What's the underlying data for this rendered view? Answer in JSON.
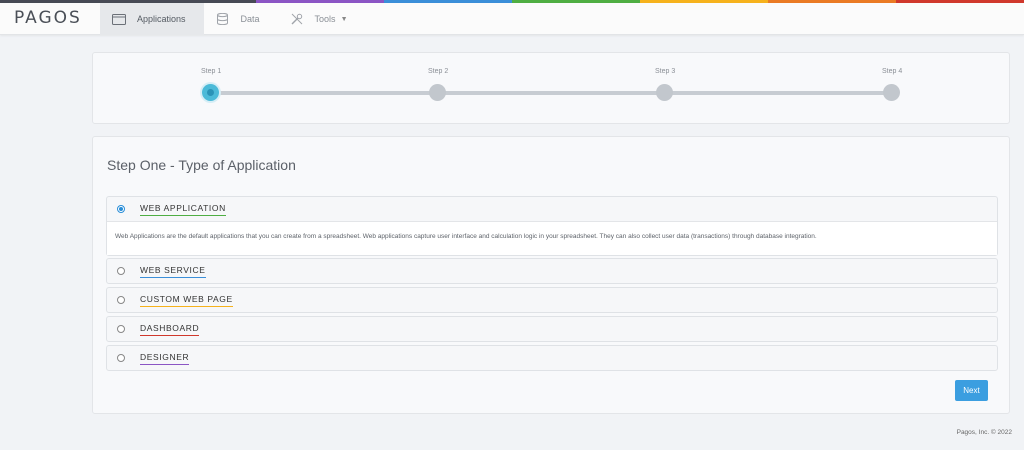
{
  "brand": {
    "logo_text": "PAGOS"
  },
  "accent_colors": [
    "#474a55",
    "#8b55c4",
    "#3b8fd9",
    "#4fae43",
    "#f6b21c",
    "#ea7b25",
    "#d0382c"
  ],
  "nav": {
    "applications": "Applications",
    "data": "Data",
    "tools": "Tools"
  },
  "wizard": {
    "current_step": 1,
    "steps": [
      "Step 1",
      "Step 2",
      "Step 3",
      "Step 4"
    ]
  },
  "main": {
    "heading": "Step One - Type of Application",
    "options": [
      {
        "title": "WEB APPLICATION",
        "selected": true,
        "underline": "#4fae43",
        "description": "Web Applications are the default applications that you can create from a spreadsheet. Web applications capture user interface and calculation logic in your spreadsheet. They can also collect user data (transactions) through database integration."
      },
      {
        "title": "WEB SERVICE",
        "selected": false,
        "underline": "#3b8fd9"
      },
      {
        "title": "CUSTOM WEB PAGE",
        "selected": false,
        "underline": "#f6b21c"
      },
      {
        "title": "DASHBOARD",
        "selected": false,
        "underline": "#d0382c"
      },
      {
        "title": "DESIGNER",
        "selected": false,
        "underline": "#8b55c4"
      }
    ],
    "next_label": "Next"
  },
  "footer": {
    "copyright": "Pagos, Inc. © 2022"
  }
}
